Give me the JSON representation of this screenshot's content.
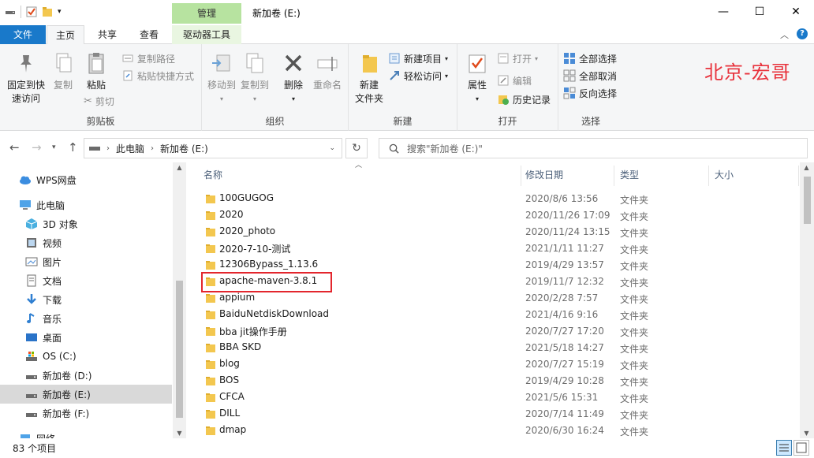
{
  "window": {
    "title": "新加卷 (E:)",
    "context_tab": "管理",
    "minimize_glyph": "—",
    "maximize_glyph": "☐",
    "close_glyph": "✕"
  },
  "ribbon_tabs": {
    "file": "文件",
    "home": "主页",
    "share": "共享",
    "view": "查看",
    "drive_tools": "驱动器工具"
  },
  "ribbon": {
    "clipboard": {
      "label": "剪贴板",
      "pin": "固定到快\n速访问",
      "pin_l1": "固定到快",
      "pin_l2": "速访问",
      "copy": "复制",
      "paste": "粘贴",
      "copy_path": "复制路径",
      "paste_shortcut": "粘贴快捷方式",
      "cut": "剪切"
    },
    "organize": {
      "label": "组织",
      "move_to": "移动到",
      "copy_to": "复制到",
      "delete": "删除",
      "rename": "重命名"
    },
    "new": {
      "label": "新建",
      "new_folder_l1": "新建",
      "new_folder_l2": "文件夹",
      "new_item": "新建项目",
      "easy_access": "轻松访问"
    },
    "open": {
      "label": "打开",
      "properties": "属性",
      "open": "打开",
      "edit": "编辑",
      "history": "历史记录"
    },
    "select": {
      "label": "选择",
      "select_all": "全部选择",
      "select_none": "全部取消",
      "invert": "反向选择"
    },
    "watermark": "北京-宏哥"
  },
  "address": {
    "path": [
      "此电脑",
      "新加卷 (E:)"
    ],
    "search_placeholder": "搜索\"新加卷 (E:)\""
  },
  "nav": {
    "items": [
      {
        "label": "WPS网盘",
        "icon": "cloud-icon",
        "indent": 0
      },
      {
        "label": "此电脑",
        "icon": "computer-icon",
        "indent": 0
      },
      {
        "label": "3D 对象",
        "icon": "cube-icon",
        "indent": 1
      },
      {
        "label": "视频",
        "icon": "video-icon",
        "indent": 1
      },
      {
        "label": "图片",
        "icon": "picture-icon",
        "indent": 1
      },
      {
        "label": "文档",
        "icon": "document-icon",
        "indent": 1
      },
      {
        "label": "下载",
        "icon": "download-icon",
        "indent": 1
      },
      {
        "label": "音乐",
        "icon": "music-icon",
        "indent": 1
      },
      {
        "label": "桌面",
        "icon": "desktop-icon",
        "indent": 1
      },
      {
        "label": "OS (C:)",
        "icon": "os-drive-icon",
        "indent": 1
      },
      {
        "label": "新加卷 (D:)",
        "icon": "drive-icon",
        "indent": 1
      },
      {
        "label": "新加卷 (E:)",
        "icon": "drive-icon",
        "indent": 1,
        "selected": true
      },
      {
        "label": "新加卷 (F:)",
        "icon": "drive-icon",
        "indent": 1
      },
      {
        "label": "网络",
        "icon": "network-icon",
        "indent": 0
      }
    ]
  },
  "columns": {
    "name": "名称",
    "date": "修改日期",
    "type": "类型",
    "size": "大小"
  },
  "files": [
    {
      "name": "100GUGOG",
      "date": "2020/8/6 13:56",
      "type": "文件夹"
    },
    {
      "name": "2020",
      "date": "2020/11/26 17:09",
      "type": "文件夹"
    },
    {
      "name": "2020_photo",
      "date": "2020/11/24 13:15",
      "type": "文件夹"
    },
    {
      "name": "2020-7-10-测试",
      "date": "2021/1/11 11:27",
      "type": "文件夹"
    },
    {
      "name": "12306Bypass_1.13.6",
      "date": "2019/4/29 13:57",
      "type": "文件夹"
    },
    {
      "name": "apache-maven-3.8.1",
      "date": "2019/11/7 12:32",
      "type": "文件夹",
      "highlighted": true
    },
    {
      "name": "appium",
      "date": "2020/2/28 7:57",
      "type": "文件夹"
    },
    {
      "name": "BaiduNetdiskDownload",
      "date": "2021/4/16 9:16",
      "type": "文件夹"
    },
    {
      "name": "bba jit操作手册",
      "date": "2020/7/27 17:20",
      "type": "文件夹"
    },
    {
      "name": "BBA SKD",
      "date": "2021/5/18 14:27",
      "type": "文件夹"
    },
    {
      "name": "blog",
      "date": "2020/7/27 15:19",
      "type": "文件夹"
    },
    {
      "name": "BOS",
      "date": "2019/4/29 10:28",
      "type": "文件夹"
    },
    {
      "name": "CFCA",
      "date": "2021/5/6 15:31",
      "type": "文件夹"
    },
    {
      "name": "DILL",
      "date": "2020/7/14 11:49",
      "type": "文件夹"
    },
    {
      "name": "dmap",
      "date": "2020/6/30 16:24",
      "type": "文件夹"
    }
  ],
  "status": {
    "item_count": "83 个项目"
  },
  "colors": {
    "file_tab": "#1979ca",
    "context_tab": "#b7e3a0",
    "highlight_box": "#e3262d",
    "watermark": "#e8323c",
    "folder": "#f3c74f"
  }
}
